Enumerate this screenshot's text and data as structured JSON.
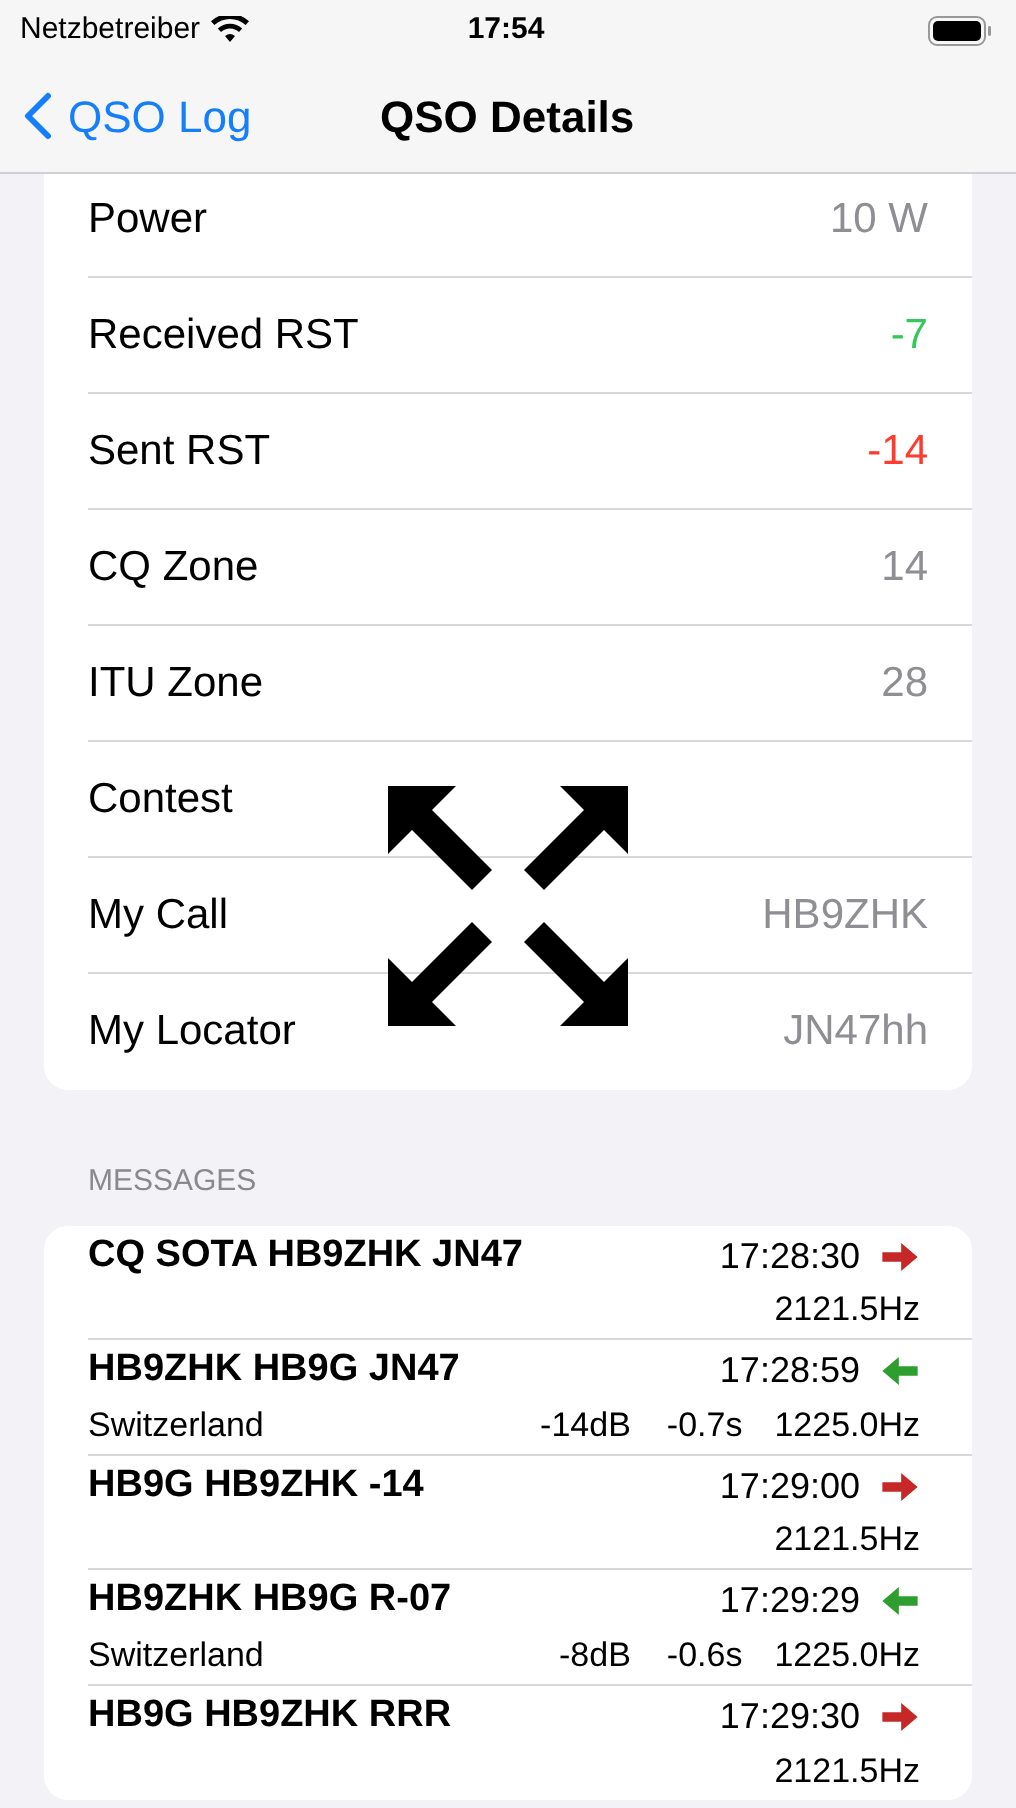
{
  "status_bar": {
    "carrier": "Netzbetreiber",
    "time": "17:54"
  },
  "nav": {
    "back": "QSO Log",
    "title": "QSO Details"
  },
  "details": [
    {
      "label": "Power",
      "value": "10 W",
      "color": "#8e8e93"
    },
    {
      "label": "Received RST",
      "value": "-7",
      "color": "#34c759"
    },
    {
      "label": "Sent RST",
      "value": "-14",
      "color": "#ff3b30"
    },
    {
      "label": "CQ Zone",
      "value": "14",
      "color": "#8e8e93"
    },
    {
      "label": "ITU Zone",
      "value": "28",
      "color": "#8e8e93"
    },
    {
      "label": "Contest"
    },
    {
      "label": "My Call",
      "value": "HB9ZHK",
      "color": "#8e8e93"
    },
    {
      "label": "My Locator",
      "value": "JN47hh",
      "color": "#8e8e93"
    }
  ],
  "messages": {
    "header": "MESSAGES",
    "items": [
      {
        "text": "CQ SOTA HB9ZHK JN47",
        "time": "17:28:30",
        "kind": "sent",
        "freq": "2121.5Hz"
      },
      {
        "text": "HB9ZHK HB9G JN47",
        "time": "17:28:59",
        "kind": "received",
        "country": "Switzerland",
        "snr": "-14dB",
        "dt": "-0.7s",
        "freq": "1225.0Hz"
      },
      {
        "text": "HB9G HB9ZHK -14",
        "time": "17:29:00",
        "kind": "sent",
        "freq": "2121.5Hz"
      },
      {
        "text": "HB9ZHK HB9G R-07",
        "time": "17:29:29",
        "kind": "received",
        "country": "Switzerland",
        "snr": "-8dB",
        "dt": "-0.6s",
        "freq": "1225.0Hz"
      },
      {
        "text": "HB9G HB9ZHK RRR",
        "time": "17:29:30",
        "kind": "sent",
        "freq": "2121.5Hz"
      }
    ]
  }
}
